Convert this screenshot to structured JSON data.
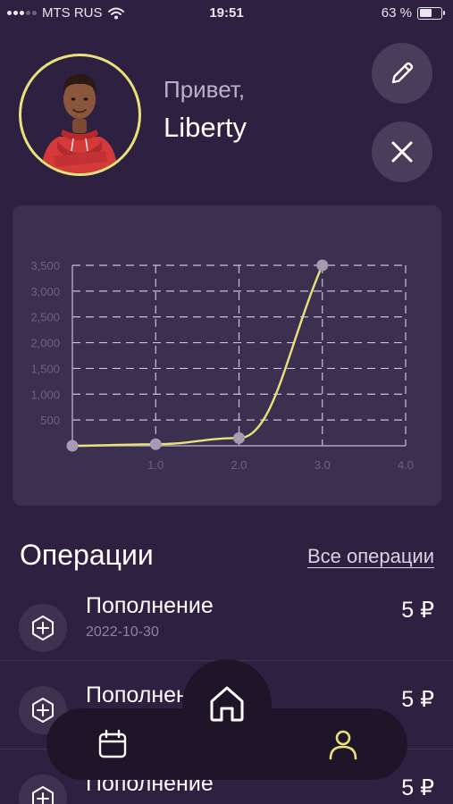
{
  "status_bar": {
    "carrier": "MTS RUS",
    "time": "19:51",
    "battery_percent": "63 %",
    "battery_level": 0.63
  },
  "profile": {
    "greeting": "Привет,",
    "name": "Liberty"
  },
  "chart_data": {
    "type": "line",
    "x": [
      0,
      1,
      2,
      3
    ],
    "y": [
      0,
      30,
      150,
      3500
    ],
    "xlim": [
      0,
      4
    ],
    "ylim": [
      0,
      3500
    ],
    "x_ticks": [
      "1.0",
      "2.0",
      "3.0",
      "4.0"
    ],
    "y_ticks": [
      "500",
      "1,000",
      "1,500",
      "2,000",
      "2,500",
      "3,000",
      "3,500"
    ],
    "grid": true,
    "line_color": "#e9e27a",
    "point_color": "#a59cb3"
  },
  "operations": {
    "title": "Операции",
    "all_link": "Все операции",
    "items": [
      {
        "name": "Пополнение",
        "date": "2022-10-30",
        "amount": "5 ₽"
      },
      {
        "name": "Пополнение",
        "date": "",
        "amount": "5 ₽"
      },
      {
        "name": "Пополнение",
        "date": "",
        "amount": "5 ₽"
      }
    ]
  },
  "nav": {
    "items": [
      "calendar-icon",
      "home-icon",
      "user-icon"
    ],
    "active_color": "#e9e27a"
  },
  "colors": {
    "background": "#2e2040",
    "card": "#3c3050",
    "accent": "#e9e27a"
  }
}
